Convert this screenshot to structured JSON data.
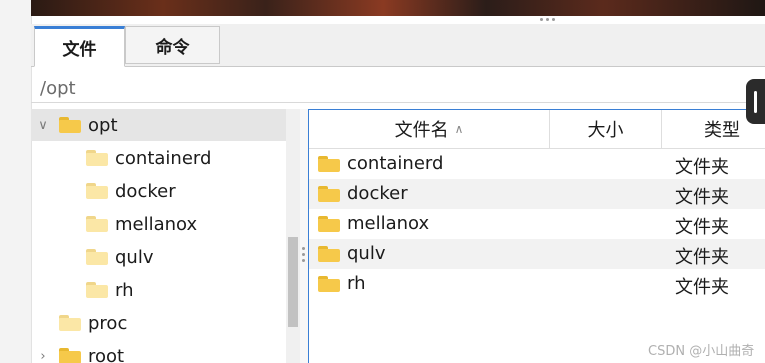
{
  "tabs": [
    {
      "label": "文件",
      "active": true
    },
    {
      "label": "命令",
      "active": false
    }
  ],
  "path": "/opt",
  "tree": [
    {
      "label": "opt",
      "expanded": true,
      "selected": true
    },
    {
      "label": "containerd"
    },
    {
      "label": "docker"
    },
    {
      "label": "mellanox"
    },
    {
      "label": "qulv"
    },
    {
      "label": "rh"
    },
    {
      "label": "proc"
    },
    {
      "label": "root",
      "expandable": true
    }
  ],
  "columns": {
    "name": "文件名",
    "size": "大小",
    "type": "类型"
  },
  "files": [
    {
      "name": "containerd",
      "type": "文件夹"
    },
    {
      "name": "docker",
      "type": "文件夹"
    },
    {
      "name": "mellanox",
      "type": "文件夹"
    },
    {
      "name": "qulv",
      "type": "文件夹"
    },
    {
      "name": "rh",
      "type": "文件夹"
    }
  ],
  "icons": {
    "chevron_expanded": "chevron-down-icon",
    "chevron_collapsed": "chevron-right-icon",
    "folder": "folder-icon",
    "sort": "sort-ascending-icon"
  },
  "colors": {
    "accent": "#3a7fd5",
    "folder": "#f6c94a",
    "selection": "#e5e5e5"
  },
  "watermark": "CSDN @小山曲奇"
}
